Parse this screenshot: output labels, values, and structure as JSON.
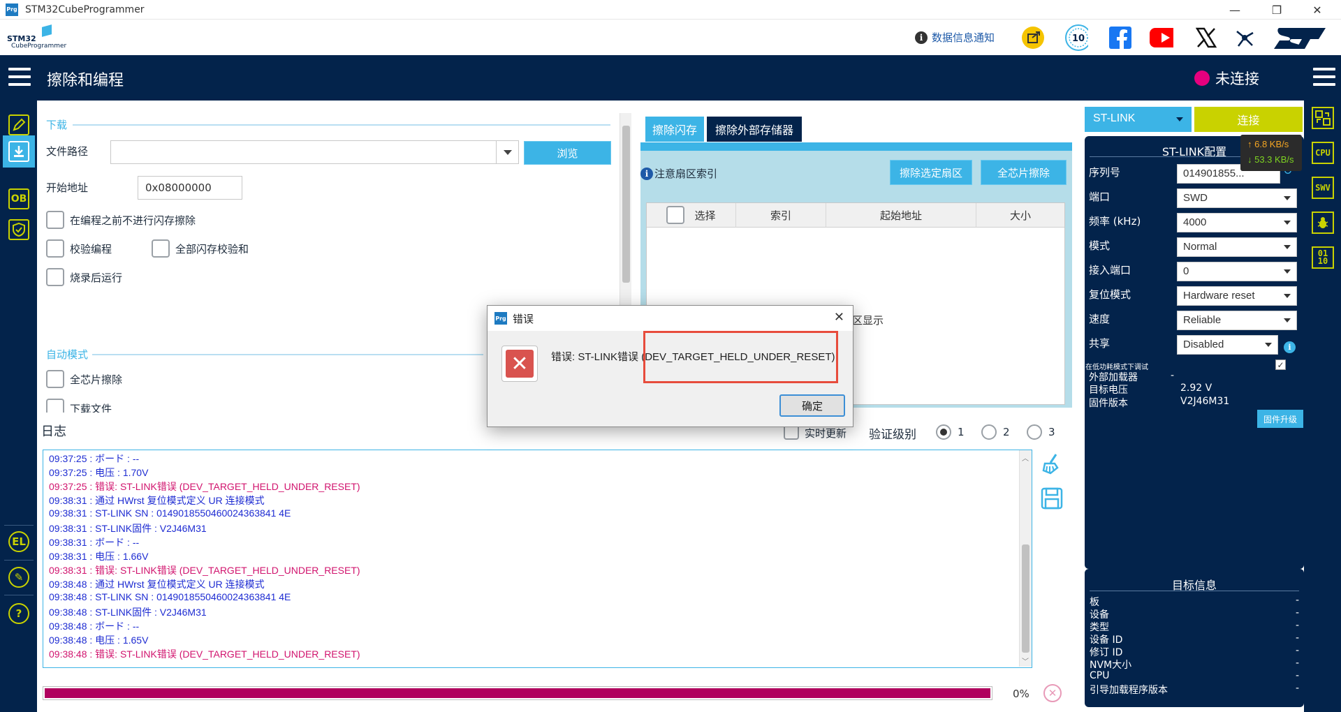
{
  "window": {
    "title": "STM32CubeProgrammer",
    "icon_text": "Prg"
  },
  "brand": {
    "logo_line1": "STM32",
    "logo_line2": "CubeProgrammer",
    "notice_label": "数据信息通知"
  },
  "header": {
    "page_title": "擦除和编程",
    "connection_status": "未连接",
    "status_color": "#e6007e"
  },
  "download": {
    "section_title": "下载",
    "file_path_label": "文件路径",
    "file_path_value": "",
    "browse_label": "浏览",
    "start_address_label": "开始地址",
    "start_address_value": "0x08000000",
    "options": [
      {
        "label": "在编程之前不进行闪存擦除",
        "checked": false
      },
      {
        "label": "校验编程",
        "checked": false
      },
      {
        "label": "全部闪存校验和",
        "checked": false
      },
      {
        "label": "烧录后运行",
        "checked": false
      }
    ]
  },
  "automatic": {
    "section_title": "自动模式",
    "options": [
      {
        "label": "全芯片擦除",
        "checked": false
      },
      {
        "label": "下载文件",
        "checked": false
      }
    ]
  },
  "erase": {
    "tabs": [
      {
        "label": "擦除闪存",
        "active": true
      },
      {
        "label": "擦除外部存储器",
        "active": false
      }
    ],
    "note_label": "注意扇区索引",
    "erase_selected_label": "擦除选定扇区",
    "full_chip_erase_label": "全芯片擦除",
    "columns": [
      "选择",
      "索引",
      "起始地址",
      "大小"
    ],
    "hidden_text": "区显示"
  },
  "log": {
    "title": "日志",
    "live_update_label": "实时更新",
    "verbosity_label": "验证级别",
    "levels": [
      "1",
      "2",
      "3"
    ],
    "selected_level": "1",
    "lines": [
      {
        "text": "09:37:25 : ボード    : --",
        "type": "info"
      },
      {
        "text": "09:37:25 : 电压      : 1.70V",
        "type": "info"
      },
      {
        "text": "09:37:25 : 错误: ST-LINK错误 (DEV_TARGET_HELD_UNDER_RESET)",
        "type": "err"
      },
      {
        "text": "09:38:31 : 通过 HWrst 复位模式定义 UR 连接模式",
        "type": "info"
      },
      {
        "text": "09:38:31 : ST-LINK SN  : 0149018550460024363841 4E",
        "type": "info"
      },
      {
        "text": "09:38:31 : ST-LINK固件 :  V2J46M31",
        "type": "info"
      },
      {
        "text": "09:38:31 : ボード    : --",
        "type": "info"
      },
      {
        "text": "09:38:31 : 电压      : 1.66V",
        "type": "info"
      },
      {
        "text": "09:38:31 : 错误: ST-LINK错误 (DEV_TARGET_HELD_UNDER_RESET)",
        "type": "err"
      },
      {
        "text": "09:38:48 : 通过 HWrst 复位模式定义 UR 连接模式",
        "type": "info"
      },
      {
        "text": "09:38:48 : ST-LINK SN  : 0149018550460024363841 4E",
        "type": "info"
      },
      {
        "text": "09:38:48 : ST-LINK固件 :  V2J46M31",
        "type": "info"
      },
      {
        "text": "09:38:48 : ボード    : --",
        "type": "info"
      },
      {
        "text": "09:38:48 : 电压      : 1.65V",
        "type": "info"
      },
      {
        "text": "09:38:48 : 错误: ST-LINK错误 (DEV_TARGET_HELD_UNDER_RESET)",
        "type": "err"
      }
    ]
  },
  "progress": {
    "value": 1.0,
    "percent_label": "0%"
  },
  "stlink": {
    "interface_value": "ST-LINK",
    "connect_label": "连接",
    "config_title": "ST-LINK配置",
    "upload_speed": "↑ 6.8 KB/s",
    "download_speed": "↓ 53.3 KB/s",
    "fields": [
      {
        "label": "序列号",
        "value": "014901855..."
      },
      {
        "label": "端口",
        "value": "SWD"
      },
      {
        "label": "频率 (kHz)",
        "value": "4000"
      },
      {
        "label": "模式",
        "value": "Normal"
      },
      {
        "label": "接入端口",
        "value": "0"
      },
      {
        "label": "复位模式",
        "value": "Hardware reset"
      },
      {
        "label": "速度",
        "value": "Reliable"
      },
      {
        "label": "共享",
        "value": "Disabled"
      }
    ],
    "low_power_label": "在低功耗模式下调试",
    "ext_loader_label": "外部加载器",
    "ext_loader_value": "-",
    "target_voltage_label": "目标电压",
    "target_voltage_value": "2.92 V",
    "firmware_label": "固件版本",
    "firmware_value": "V2J46M31",
    "firmware_upgrade_label": "固件升级"
  },
  "target_info": {
    "title": "目标信息",
    "rows": [
      {
        "label": "板",
        "value": "-"
      },
      {
        "label": "设备",
        "value": "-"
      },
      {
        "label": "类型",
        "value": "-"
      },
      {
        "label": "设备 ID",
        "value": "-"
      },
      {
        "label": "修订 ID",
        "value": "-"
      },
      {
        "label": "NVM大小",
        "value": "-"
      },
      {
        "label": "CPU",
        "value": "-"
      },
      {
        "label": "引导加载程序版本",
        "value": "-"
      }
    ]
  },
  "right_nav": [
    {
      "label": "CPU"
    },
    {
      "label": "SWV"
    },
    {
      "label": "01\n10"
    }
  ],
  "dialog": {
    "icon_text": "Prg",
    "title": "错误",
    "message_prefix": "错误: ST-LINK错误",
    "message_code": "(DEV_TARGET_HELD_UNDER_RESET)",
    "ok_label": "确定"
  },
  "colors": {
    "navy": "#03234b",
    "accent": "#3cb4e6",
    "lime": "#c9d200",
    "error": "#d1146e",
    "progress": "#b0005e"
  }
}
